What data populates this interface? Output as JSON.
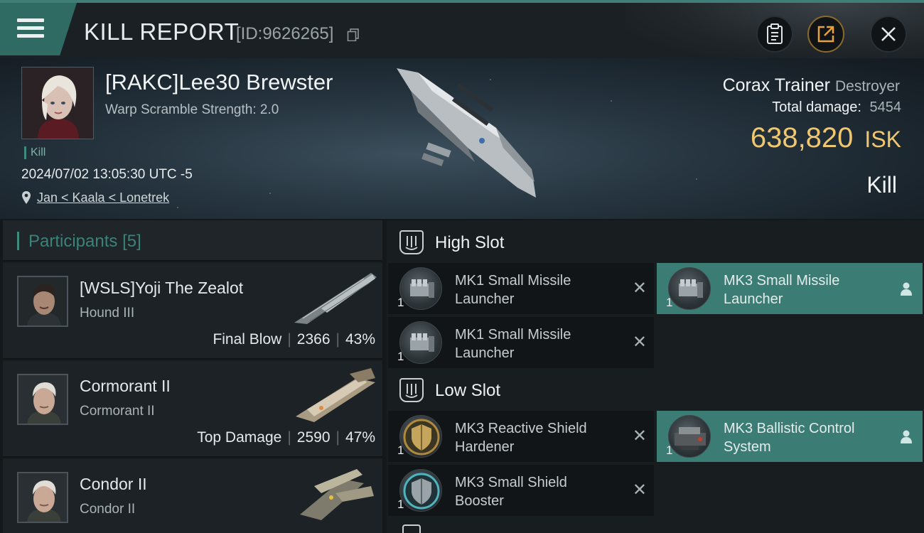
{
  "header_bar": {
    "title": "KILL REPORT",
    "report_id": "[ID:9626265]",
    "icons": [
      "menu-icon",
      "copy-icon",
      "clipboard-icon",
      "share-icon",
      "close-icon"
    ]
  },
  "victim": {
    "name": "[RAKC]Lee30 Brewster",
    "warp_scramble": "Warp Scramble Strength: 2.0",
    "kill_tag": "Kill",
    "timestamp": "2024/07/02 13:05:30 UTC -5",
    "location": "Jan < Kaala < Lonetrek",
    "ship_name": "Corax Trainer",
    "ship_class": "Destroyer",
    "total_damage_label": "Total damage:",
    "total_damage": "5454",
    "isk_value": "638,820",
    "isk_unit": "ISK",
    "result": "Kill"
  },
  "participants": {
    "title": "Participants",
    "count": "[5]",
    "rows": [
      {
        "name": "[WSLS]Yoji The Zealot",
        "ship": "Hound III",
        "role": "Final Blow",
        "damage": "2366",
        "percent": "43%"
      },
      {
        "name": "Cormorant II",
        "ship": "Cormorant II",
        "role": "Top Damage",
        "damage": "2590",
        "percent": "47%"
      },
      {
        "name": "Condor II",
        "ship": "Condor II",
        "role": "",
        "damage": "",
        "percent": ""
      }
    ]
  },
  "slots": {
    "high": {
      "title": "High Slot",
      "modules": [
        {
          "name": "MK1 Small Missile Launcher",
          "qty": "1",
          "state": "destroyed"
        },
        {
          "name": "MK3 Small Missile Launcher",
          "qty": "1",
          "state": "dropped"
        },
        {
          "name": "MK1 Small Missile Launcher",
          "qty": "1",
          "state": "destroyed"
        }
      ]
    },
    "low": {
      "title": "Low Slot",
      "modules": [
        {
          "name": "MK3 Reactive Shield Hardener",
          "qty": "1",
          "state": "destroyed"
        },
        {
          "name": "MK3 Ballistic Control System",
          "qty": "1",
          "state": "dropped"
        },
        {
          "name": "MK3 Small Shield Booster",
          "qty": "1",
          "state": "destroyed"
        }
      ]
    }
  },
  "colors": {
    "accent_teal": "#3b7d74",
    "isk_gold": "#f0c66e",
    "panel_dark": "#111517"
  }
}
